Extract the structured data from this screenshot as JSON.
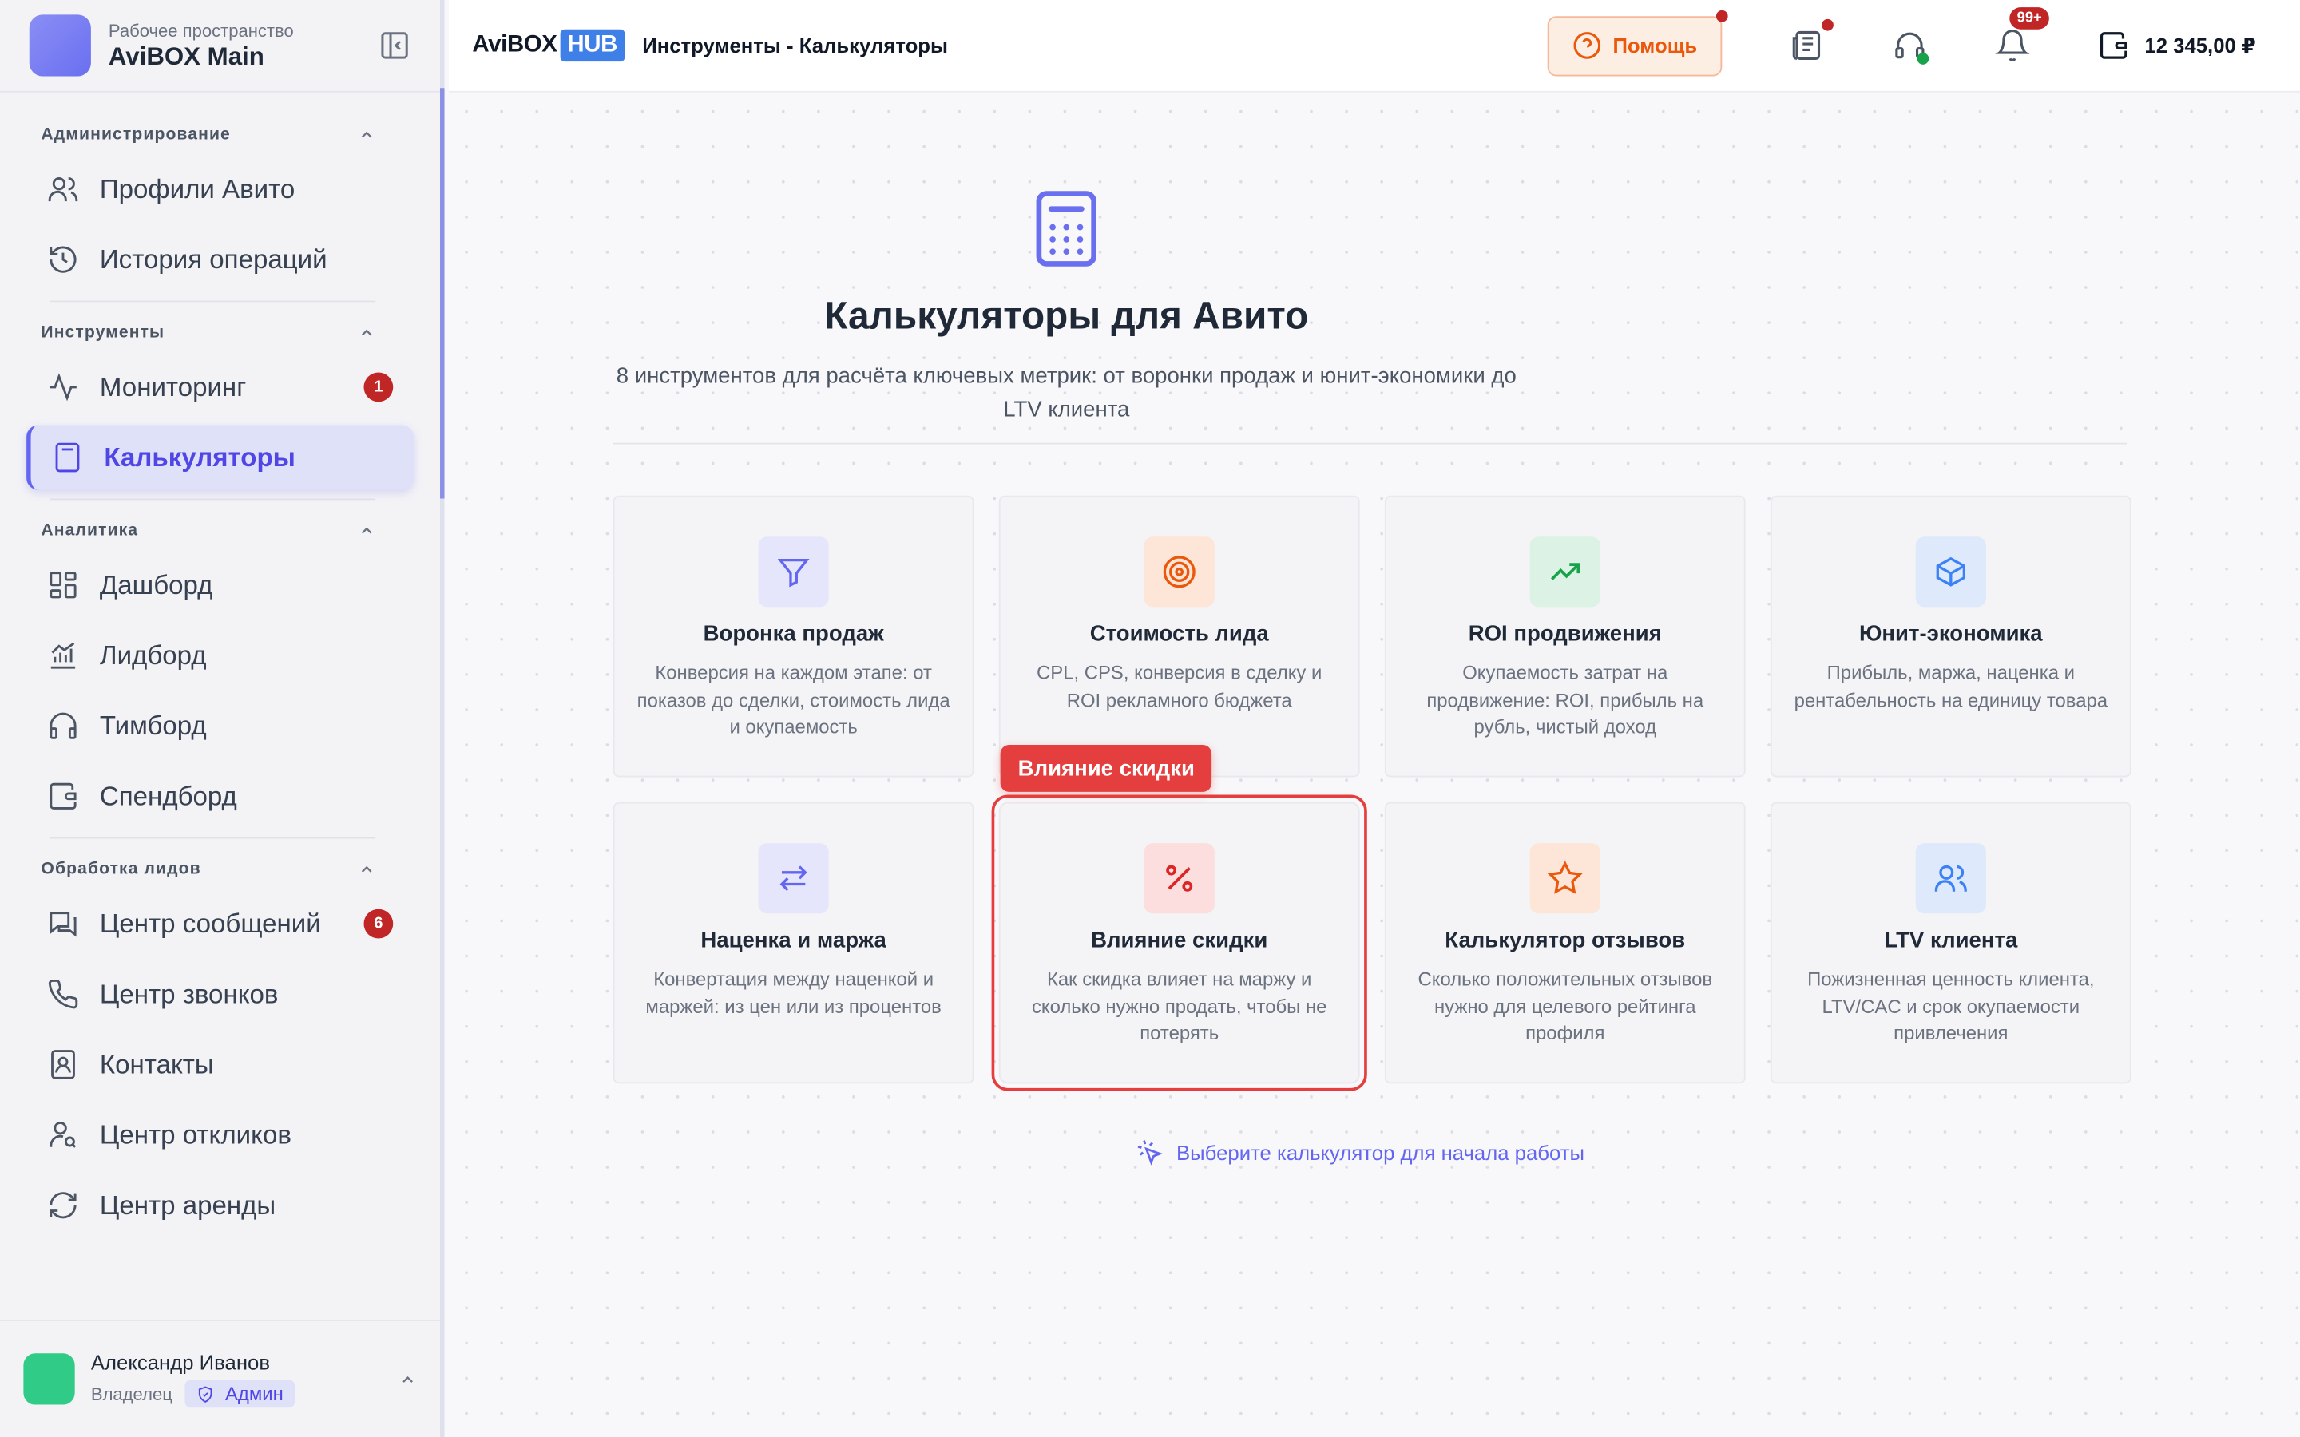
{
  "workspace": {
    "label": "Рабочее пространство",
    "name": "AviBOX Main"
  },
  "sidebar": {
    "sections": [
      {
        "title": "Администрирование",
        "items": [
          {
            "label": "Профили Авито",
            "icon": "users-icon"
          },
          {
            "label": "История операций",
            "icon": "history-icon"
          }
        ]
      },
      {
        "title": "Инструменты",
        "items": [
          {
            "label": "Мониторинг",
            "icon": "activity-icon",
            "badge": "1"
          },
          {
            "label": "Калькуляторы",
            "icon": "calculator-icon",
            "active": true
          }
        ]
      },
      {
        "title": "Аналитика",
        "items": [
          {
            "label": "Дашборд",
            "icon": "dashboard-icon"
          },
          {
            "label": "Лидборд",
            "icon": "bar-chart-icon"
          },
          {
            "label": "Тимборд",
            "icon": "headphones-icon"
          },
          {
            "label": "Спендборд",
            "icon": "wallet-icon"
          }
        ]
      },
      {
        "title": "Обработка лидов",
        "items": [
          {
            "label": "Центр сообщений",
            "icon": "messages-icon",
            "badge": "6"
          },
          {
            "label": "Центр звонков",
            "icon": "phone-icon"
          },
          {
            "label": "Контакты",
            "icon": "contact-icon"
          },
          {
            "label": "Центр откликов",
            "icon": "user-search-icon"
          },
          {
            "label": "Центр аренды",
            "icon": "refresh-icon"
          }
        ]
      }
    ]
  },
  "user": {
    "name": "Александр Иванов",
    "role": "Владелец",
    "badge": "Админ"
  },
  "header": {
    "brand": "AviBOX",
    "brand_hub": "HUB",
    "breadcrumb": "Инструменты - Калькуляторы",
    "help_label": "Помощь",
    "notifications_count": "99+",
    "balance": "12 345,00 ₽"
  },
  "main": {
    "title": "Калькуляторы для Авито",
    "subtitle": "8 инструментов для расчёта ключевых метрик: от воронки продаж и юнит-экономики до LTV клиента",
    "tooltip": "Влияние скидки",
    "hint": "Выберите калькулятор для начала работы",
    "cards": [
      {
        "title": "Воронка продаж",
        "desc": "Конверсия на каждом этапе: от показов до сделки, стоимость лида и окупаемость",
        "icon": "funnel-icon",
        "color": "#6366f1",
        "bg": "#e5e6fb"
      },
      {
        "title": "Стоимость лида",
        "desc": "CPL, CPS, конверсия в сделку и ROI рекламного бюджета",
        "icon": "target-icon",
        "color": "#ea580c",
        "bg": "#fde5d8"
      },
      {
        "title": "ROI продвижения",
        "desc": "Окупаемость затрат на продвижение: ROI, прибыль на рубль, чистый доход",
        "icon": "trending-up-icon",
        "color": "#16a34a",
        "bg": "#dcf2e4"
      },
      {
        "title": "Юнит-экономика",
        "desc": "Прибыль, маржа, наценка и рентабельность на единицу товара",
        "icon": "box-icon",
        "color": "#3b82f6",
        "bg": "#dee9fb"
      },
      {
        "title": "Наценка и маржа",
        "desc": "Конвертация между наценкой и маржей: из цен или из процентов",
        "icon": "swap-icon",
        "color": "#6366f1",
        "bg": "#e5e6fb"
      },
      {
        "title": "Влияние скидки",
        "desc": "Как скидка влияет на маржу и сколько нужно продать, чтобы не потерять",
        "icon": "percent-icon",
        "color": "#dc2626",
        "bg": "#fbdedd",
        "highlight": true
      },
      {
        "title": "Калькулятор отзывов",
        "desc": "Сколько положительных отзывов нужно для целевого рейтинга профиля",
        "icon": "star-icon",
        "color": "#ea580c",
        "bg": "#fde5d8"
      },
      {
        "title": "LTV клиента",
        "desc": "Пожизненная ценность клиента, LTV/CAC и срок окупаемости привлечения",
        "icon": "users-icon",
        "color": "#3b82f6",
        "bg": "#dee9fb"
      }
    ]
  }
}
